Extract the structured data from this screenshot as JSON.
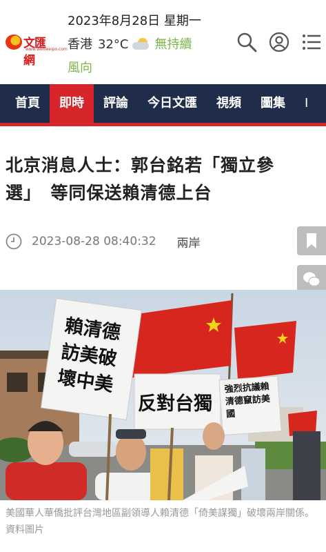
{
  "header": {
    "logo_text": "文匯網",
    "logo_url": "www.wenweipo.com",
    "date": "2023年8月28日 星期一",
    "city": "香港",
    "temperature": "32°C",
    "wind": "無持續",
    "wind2": "風向",
    "icons": [
      "search-icon",
      "user-icon",
      "menu-icon"
    ]
  },
  "nav": {
    "items": [
      {
        "label": "首頁"
      },
      {
        "label": "即時"
      },
      {
        "label": "評論"
      },
      {
        "label": "今日文匯"
      },
      {
        "label": "視頻"
      },
      {
        "label": "圖集"
      },
      {
        "label": "I"
      }
    ],
    "active_index": 1
  },
  "article": {
    "title_line1": "北京消息人士：郭台銘若「獨立參",
    "title_line2": "選」　等同保送賴清德上台",
    "datetime": "2023-08-28 08:40:32",
    "category": "兩岸",
    "photo": {
      "signs": {
        "sign1": "賴清德訪美破壞中美",
        "sign2": "反對台獨",
        "sign3": "強烈抗議賴清德竄訪美國"
      }
    },
    "caption": "美國華人華僑批評台灣地區副領導人賴清德「倚美謀獨」破壞兩岸關係。資料圖片"
  },
  "share_bar": [
    "bookmark-icon",
    "wechat-icon",
    "facebook-icon",
    "weibo-icon",
    "scroll-top-icon"
  ],
  "colors": {
    "nav_bg": "#1f2d4a",
    "accent_red": "#d6252b",
    "wind_green": "#7bb54b"
  }
}
